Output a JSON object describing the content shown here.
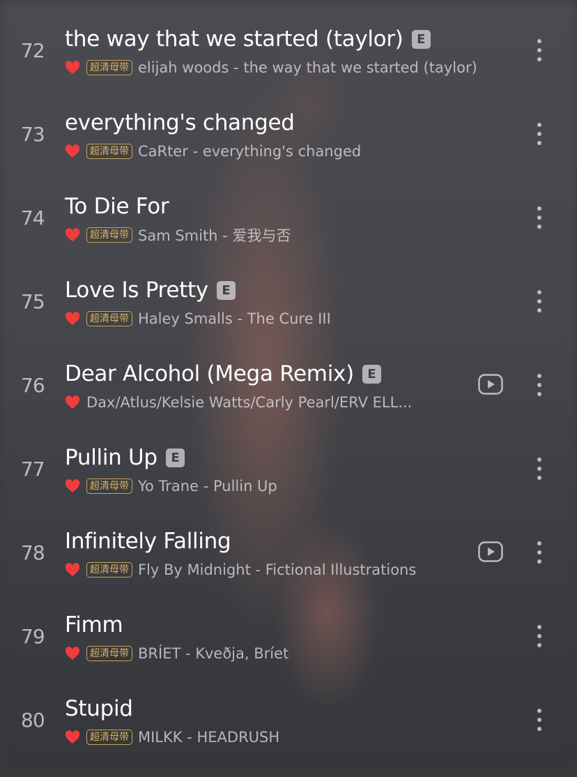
{
  "quality_badge": "超清母带",
  "colors": {
    "heart": "#f23b3b",
    "badge": "#d6b06a"
  },
  "songs": [
    {
      "index": "72",
      "title": "the way that we started (taylor)",
      "explicit": "E",
      "subtitle": "elijah woods - the way that we started (taylor)"
    },
    {
      "index": "73",
      "title": "everything's changed",
      "subtitle": "CaRter - everything's changed"
    },
    {
      "index": "74",
      "title": "To Die For",
      "subtitle": "Sam Smith - 爱我与否"
    },
    {
      "index": "75",
      "title": "Love Is Pretty",
      "explicit": "E",
      "subtitle": "Haley Smalls - The Cure III"
    },
    {
      "index": "76",
      "title": "Dear Alcohol (Mega Remix)",
      "explicit": "E",
      "subtitle": "Dax/Atlus/Kelsie Watts/Carly Pearl/ERV ELL...",
      "has_mv": true,
      "no_badge": true
    },
    {
      "index": "77",
      "title": "Pullin Up",
      "explicit": "E",
      "subtitle": "Yo Trane - Pullin Up"
    },
    {
      "index": "78",
      "title": "Infinitely Falling",
      "subtitle": "Fly By Midnight - Fictional Illustrations",
      "has_mv": true
    },
    {
      "index": "79",
      "title": "Fimm",
      "subtitle": "BRÍET - Kveðja, Bríet"
    },
    {
      "index": "80",
      "title": "Stupid",
      "subtitle": "MILKK - HEADRUSH"
    }
  ],
  "icons": {
    "heart": "heart-icon",
    "more": "more-vertical-icon",
    "mv": "play-video-icon",
    "explicit": "explicit-badge"
  }
}
